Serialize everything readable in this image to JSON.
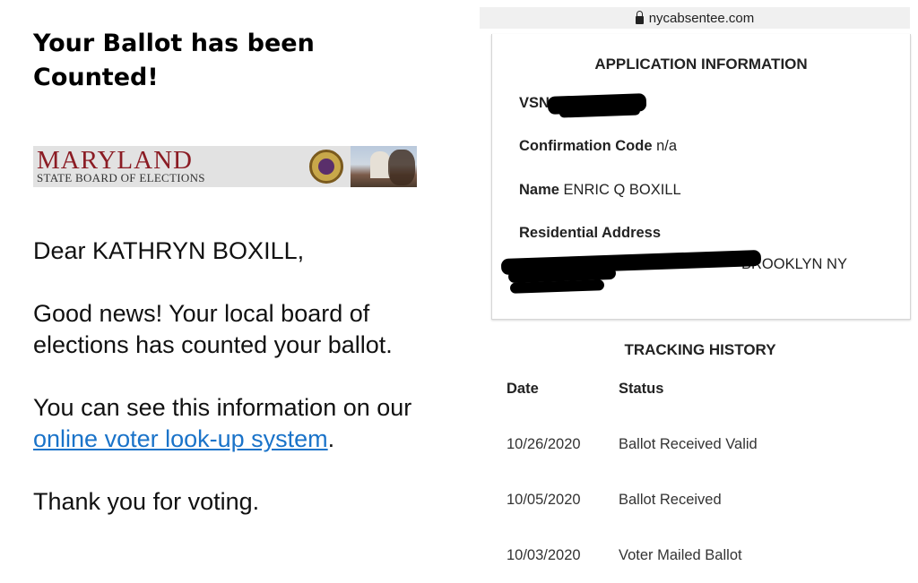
{
  "email": {
    "headline_line1": "Your Ballot has been",
    "headline_line2": "Counted!",
    "banner": {
      "title": "MARYLAND",
      "subtitle": "STATE BOARD OF ELECTIONS"
    },
    "greeting": "Dear KATHRYN BOXILL,",
    "paragraph1": "Good news! Your local board of elections has counted your ballot.",
    "paragraph2_prefix": "You can see this information on our ",
    "link_text": "online voter look-up system",
    "paragraph2_suffix": ".",
    "closing": "Thank you for voting."
  },
  "browser": {
    "url": "nycabsentee.com",
    "lock_icon": "lock-icon"
  },
  "application": {
    "title": "APPLICATION INFORMATION",
    "vsn_label": "VSN",
    "confirmation_label": "Confirmation Code",
    "confirmation_value": "n/a",
    "name_label": "Name",
    "name_value": "ENRIC Q BOXILL",
    "address_label": "Residential Address",
    "address_visible": "BROOKLYN NY"
  },
  "tracking": {
    "title": "TRACKING HISTORY",
    "columns": [
      "Date",
      "Status"
    ],
    "rows": [
      {
        "date": "10/26/2020",
        "status": "Ballot Received Valid"
      },
      {
        "date": "10/05/2020",
        "status": "Ballot Received"
      },
      {
        "date": "10/03/2020",
        "status": "Voter Mailed Ballot"
      }
    ]
  },
  "colors": {
    "link": "#1a73c9",
    "maryland_red": "#8b1c24"
  }
}
